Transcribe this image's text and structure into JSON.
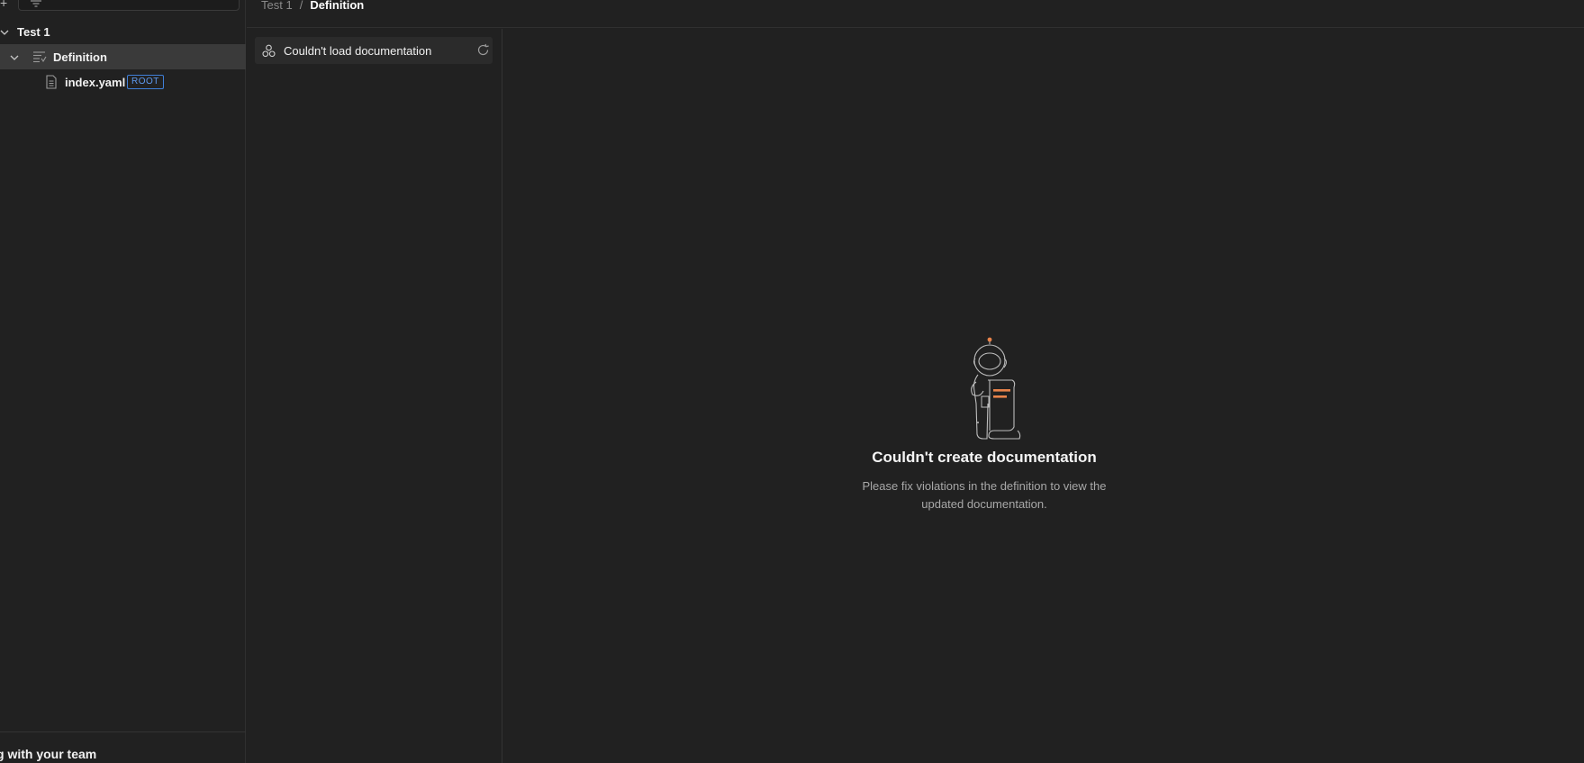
{
  "sidebar": {
    "workspace": {
      "label": "Test 1"
    },
    "definition": {
      "label": "Definition"
    },
    "file": {
      "label": "index.yaml",
      "badge": "ROOT"
    },
    "footer_text": "g with your team"
  },
  "header": {
    "breadcrumb_parent": "Test 1",
    "breadcrumb_separator": "/",
    "breadcrumb_current": "Definition"
  },
  "doc_panel": {
    "error_text": "Couldn't load documentation"
  },
  "empty_state": {
    "title": "Couldn't create documentation",
    "description": "Please fix violations in the definition to view the updated documentation."
  },
  "colors": {
    "background": "#212121",
    "badge": "#3f7fd8",
    "accent": "#e8834a"
  }
}
